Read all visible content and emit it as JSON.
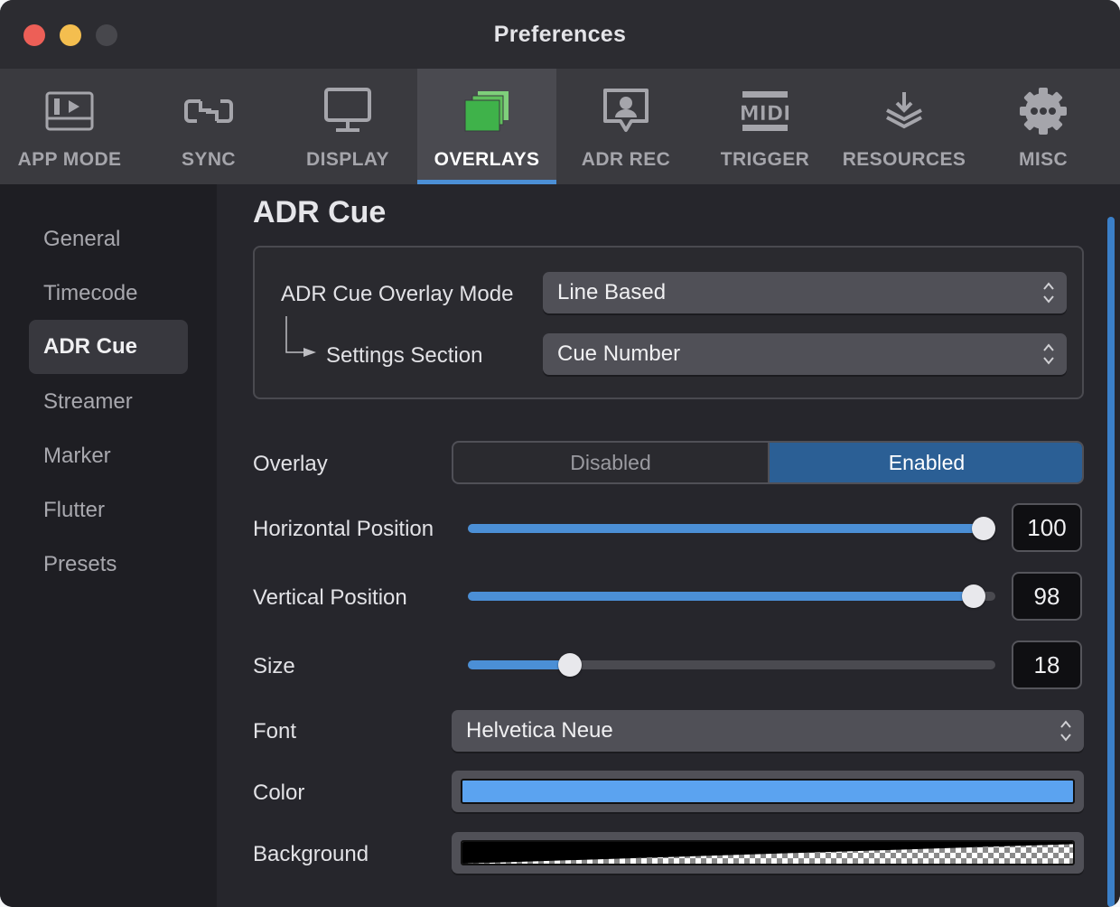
{
  "window": {
    "title": "Preferences"
  },
  "toolbar": {
    "tabs": [
      {
        "label": "APP MODE",
        "icon": "app-mode-icon",
        "active": false
      },
      {
        "label": "SYNC",
        "icon": "sync-icon",
        "active": false
      },
      {
        "label": "DISPLAY",
        "icon": "display-icon",
        "active": false
      },
      {
        "label": "OVERLAYS",
        "icon": "overlays-icon",
        "active": true
      },
      {
        "label": "ADR REC",
        "icon": "adr-rec-icon",
        "active": false
      },
      {
        "label": "TRIGGER",
        "icon": "midi-icon",
        "active": false
      },
      {
        "label": "RESOURCES",
        "icon": "resources-icon",
        "active": false
      },
      {
        "label": "MISC",
        "icon": "gear-icon",
        "active": false
      }
    ]
  },
  "sidebar": {
    "items": [
      {
        "label": "General"
      },
      {
        "label": "Timecode"
      },
      {
        "label": "ADR Cue"
      },
      {
        "label": "Streamer"
      },
      {
        "label": "Marker"
      },
      {
        "label": "Flutter"
      },
      {
        "label": "Presets"
      }
    ],
    "active": "ADR Cue"
  },
  "main": {
    "title": "ADR Cue",
    "mode_label": "ADR Cue Overlay Mode",
    "mode_value": "Line Based",
    "settings_label": "Settings Section",
    "settings_value": "Cue Number",
    "overlay_label": "Overlay",
    "overlay_options": [
      "Disabled",
      "Enabled"
    ],
    "overlay_selected": "Enabled",
    "horizontal_label": "Horizontal Position",
    "horizontal_value": "100",
    "horizontal_fraction": 1.0,
    "vertical_label": "Vertical Position",
    "vertical_value": "98",
    "vertical_fraction": 0.98,
    "size_label": "Size",
    "size_value": "18",
    "size_fraction": 0.18,
    "font_label": "Font",
    "font_value": "Helvetica Neue",
    "color_label": "Color",
    "color_value": "#5ba3f0",
    "background_label": "Background"
  },
  "colors": {
    "accent": "#4b8fd6",
    "segment_on": "#2b5f95"
  }
}
